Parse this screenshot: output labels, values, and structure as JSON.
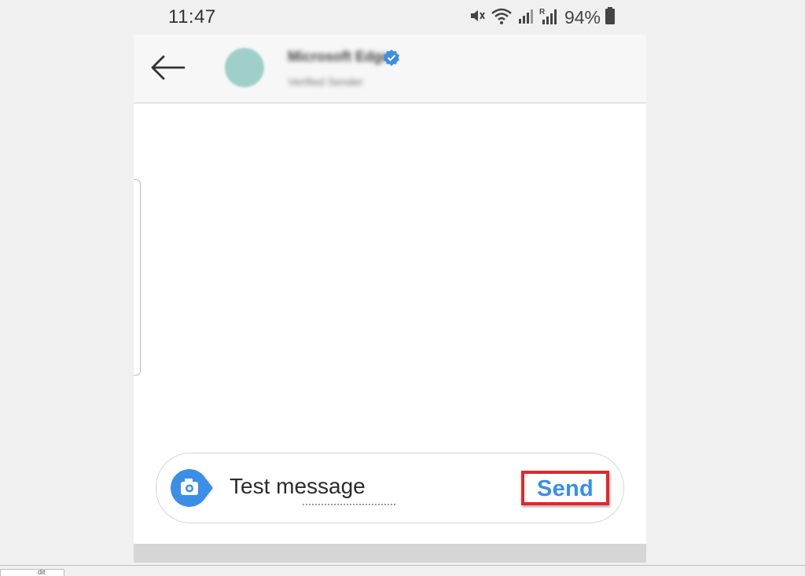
{
  "status_bar": {
    "time": "11:47",
    "battery_percent": "94%",
    "icons": [
      "mute-icon",
      "wifi-icon",
      "signal-icon",
      "roaming-signal-icon",
      "battery-icon"
    ]
  },
  "header": {
    "back_icon": "arrow-left-icon",
    "contact_name": "Microsoft Edge",
    "contact_subtitle": "Verified Sender",
    "verified_icon": "verified-badge-icon"
  },
  "composer": {
    "camera_icon": "camera-icon",
    "message_value": "Test message",
    "send_label": "Send"
  },
  "bottom_tab": {
    "label": "dit"
  },
  "colors": {
    "accent_blue": "#3a8ee6",
    "highlight_red": "#e3262b",
    "avatar": "#9fcfc9"
  }
}
